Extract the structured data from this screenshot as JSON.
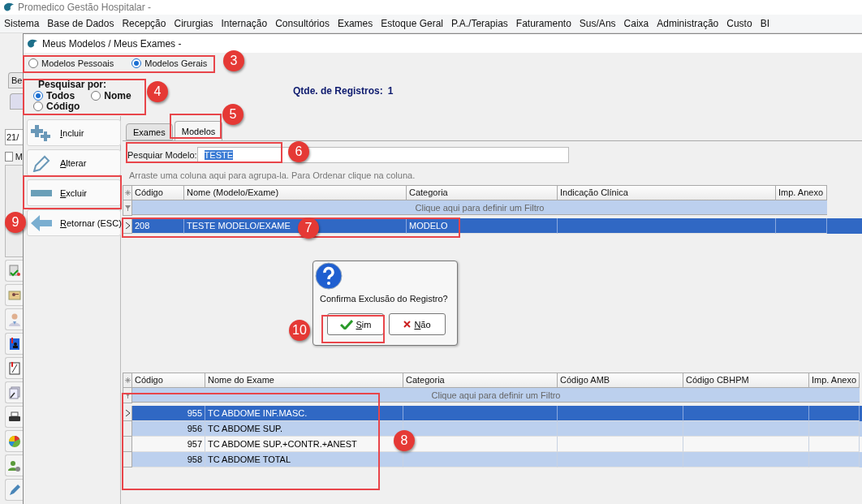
{
  "app": {
    "title": "Promedico Gestão Hospitalar -"
  },
  "menu": [
    "Sistema",
    "Base de Dados",
    "Recepção",
    "Cirurgias",
    "Internação",
    "Consultórios",
    "Exames",
    "Estoque Geral",
    "P.A./Terapias",
    "Faturamento",
    "Sus/Ans",
    "Caixa",
    "Administração",
    "Custo",
    "BI"
  ],
  "background": {
    "tab": "Be",
    "date_field": "21/",
    "checkbox": {
      "label": "M",
      "checked": false
    }
  },
  "window": {
    "title": "Meus Modelos / Meus Exames -"
  },
  "scope": [
    {
      "label": "Modelos Pessoais",
      "selected": false
    },
    {
      "label": "Modelos Gerais",
      "selected": true
    }
  ],
  "search_by": {
    "label": "Pesquisar por:",
    "options": [
      {
        "label": "Todos",
        "selected": true
      },
      {
        "label": "Nome",
        "selected": false
      },
      {
        "label": "Código",
        "selected": false
      }
    ]
  },
  "record_count": {
    "label": "Qtde. de Registros:",
    "value": "1"
  },
  "actions": [
    {
      "label": "Incluir",
      "kind": "add"
    },
    {
      "label": "Alterar",
      "kind": "edit"
    },
    {
      "label": "Excluir",
      "kind": "delete"
    },
    {
      "label": "Retornar (ESC)",
      "kind": "back"
    }
  ],
  "tabs": [
    {
      "label": "Exames",
      "selected": false
    },
    {
      "label": "Modelos",
      "selected": true
    }
  ],
  "filter": {
    "label": "Pesquiar Modelo:",
    "value": "TESTE"
  },
  "group_hint": "Arraste uma coluna aqui para agrupa-la. Para Ordenar clique na coluna.",
  "models_table": {
    "columns": [
      "Código",
      "Nome (Modelo/Exame)",
      "Categoria",
      "Indicação Clínica",
      "Imp. Anexo"
    ],
    "filter_row": "Clique aqui para definir um Filtro",
    "rows": [
      {
        "codigo": "208",
        "nome": "TESTE MODELO/EXAME",
        "categoria": "MODELO",
        "selected": true
      }
    ]
  },
  "dialog": {
    "message": "Confirma Exclusão do Registro?",
    "buttons": [
      {
        "label": "Sim",
        "kind": "confirm"
      },
      {
        "label": "Não",
        "kind": "cancel"
      }
    ]
  },
  "exams_table": {
    "columns": [
      "Código",
      "Nome do Exame",
      "Categoria",
      "Código AMB",
      "Código CBHPM",
      "Imp. Anexo"
    ],
    "filter_row": "Clique aqui para definir um Filtro",
    "rows": [
      {
        "codigo": "955",
        "nome": "TC ABDOME INF.MASC.",
        "selected": true
      },
      {
        "codigo": "956",
        "nome": "TC ABDOME SUP.",
        "selected": false
      },
      {
        "codigo": "957",
        "nome": "TC ABDOME SUP.+CONTR.+ANEST",
        "selected": false
      },
      {
        "codigo": "958",
        "nome": "TC ABDOME TOTAL",
        "selected": false
      }
    ]
  },
  "annotations": [
    {
      "number": "3"
    },
    {
      "number": "4"
    },
    {
      "number": "5"
    },
    {
      "number": "6"
    },
    {
      "number": "9"
    },
    {
      "number": "7"
    },
    {
      "number": "10"
    },
    {
      "number": "8"
    }
  ]
}
